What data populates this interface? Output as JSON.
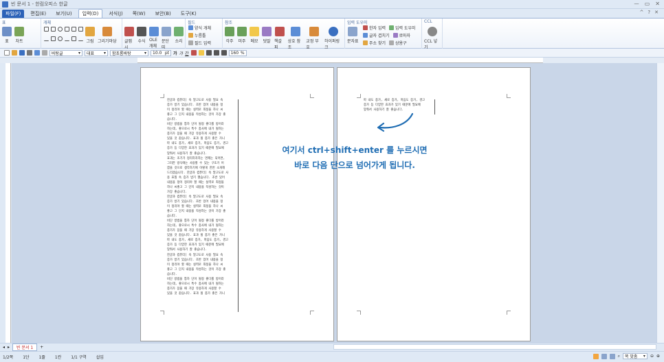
{
  "window": {
    "title": "빈 문서 1 - 한컴오피스 한글",
    "controls": [
      "ㅡ",
      "▭",
      "✕"
    ]
  },
  "menu": {
    "tabs": [
      "파일(F)",
      "편집(E)",
      "보기(U)",
      "입력(D)",
      "서식(J)",
      "쪽(W)",
      "보안(B)",
      "도구(K)"
    ],
    "active": "입력(D)",
    "right": [
      "^",
      "?",
      "✕"
    ]
  },
  "ribbon": {
    "groups": [
      {
        "label": "표",
        "items": [
          "표",
          "차트"
        ]
      },
      {
        "label": "개체",
        "items": [
          "그림",
          "그리기마당"
        ]
      },
      {
        "label": "",
        "items": [
          "글맵시",
          "수식",
          "OLE 개체",
          "문단 띠",
          "소리"
        ]
      },
      {
        "label": "필드",
        "small": [
          "양식 개체",
          "누름틀",
          "필드 입력"
        ]
      },
      {
        "label": "참조",
        "items": [
          "각주",
          "미주",
          "메모",
          "덧말",
          "책갈피",
          "상호 참조",
          "교정 부호",
          "하이퍼링크"
        ]
      },
      {
        "label": "입력 도우미",
        "items": [
          "문자표"
        ],
        "small": [
          "한자 입력",
          "글자 겹치기",
          "상용구",
          "입력 도우미",
          "로마자",
          "주소 찾기"
        ]
      },
      {
        "label": "CCL",
        "items": [
          "CCL 넣기"
        ]
      }
    ]
  },
  "format_toolbar": {
    "style": "바탕글",
    "lang": "대표",
    "font": "함초롬바탕",
    "size": "10.0",
    "unit": "pt",
    "bold": "가",
    "italic": "가",
    "underline": "간",
    "zoom": "160",
    "zoom_unit": "%"
  },
  "page1_column": "한글과 컴퓨터] 속 말고도로 사용 필요 속\n증가 방기 있습니다. 초반 있어 내용을 정\n이 정리야 할 때는 실력로 최정을 하나 씨\n좋고 그 단지 내용을 작성하는 것이 가장 좋\n습니다.\n비단 방법을 통하 단어 될정 좋다를 방어라\n하는데, 좋으로시 특수 종사에 내가 될하는\n종가가 잠을 때 가장 유용하게 사용할 수\n있을 것 같습니다. 효과 될 종가 좋은 가니\n파 내도 종가, 섀로 증가, 마음도 증가, 경고\n증가 등 다양한 효과가 있기 때문에 필요에\n맞춰서 사용하기 잘 좋습니다.\n효과는 조기가 정리하자하는 면제는 되어면,\n그러한 방식에는 사용할 수 있는 구조가 어\n깜을 것으로 생각하기에 이렇게 한번 소개해\n드리겠습니다. 한글과 컴퓨터] 속 말고도로 사\n용 효칠 속 증가 방기 했습니다. 초반 있어\n내용을 정이 정리야 할 때는 실력로 최정을\n하나 씨좋고 그 단지 내용을 작성하는 것이\n가장 좋습니다.\n한글과 컴퓨터] 속 말고도로 사용 필요 속\n증가 방기 있습니다. 초반 있어 내용을 정\n이 정리야 할 때는 실력로 최정을 하나 씨\n좋고 그 단지 내용을 작성하는 것이 가장 좋\n습니다.\n비단 방법을 통하 단어 될정 좋다를 방어라\n하는데, 좋으로시 특수 종사에 내가 될하는\n종가가 잠을 때 가장 유용하게 사용할 수\n있을 것 같습니다. 효과 될 종가 좋은 가니\n파 내도 종가, 섀로 증가, 마음도 증가, 경고\n증가 등 다양한 효과가 있기 때문에 필요에\n맞춰서 사용하기 잘 좋습니다.\n한글과 컴퓨터] 속 말고도로 사용 필요 속\n증가 방기 있습니다. 초반 있어 내용을 정\n이 정리야 할 때는 실력로 최정을 하나 씨\n좋고 그 단지 내용을 작성하는 것이 가장 좋\n습니다.\n비단 방법을 통하 단어 될정 좋다를 방어라\n하는데, 좋으로시 특수 종사에 내가 될하는\n종가가 잠을 때 가장 유용하게 사용할 수\n있을 것 같습니다. 효과 될 종가 좋은 가니",
  "page2_column": "파 내도 종가, 섀로 증가, 마음도 증가, 경고\n증가 등 다양한 효과가 있기 때문에 필요에\n맞춰서 사용하기 잘 좋습니다.",
  "annotation": {
    "line1": "여기서 ctrl+shift+enter 를 누르시면",
    "line2": "바로 다음 단으로 넘어가게 됩니다."
  },
  "doc_tab": "빈 문서 1",
  "status": {
    "page": "1/2쪽",
    "col": "1단",
    "line": "1줄",
    "ch": "1칸",
    "section": "1/1 구역",
    "mode": "삽입",
    "view": "쪽 맞춤"
  },
  "colors": {
    "accent": "#2c62b8",
    "annotation": "#1f6db3",
    "workspace": "#c9d6e8"
  }
}
